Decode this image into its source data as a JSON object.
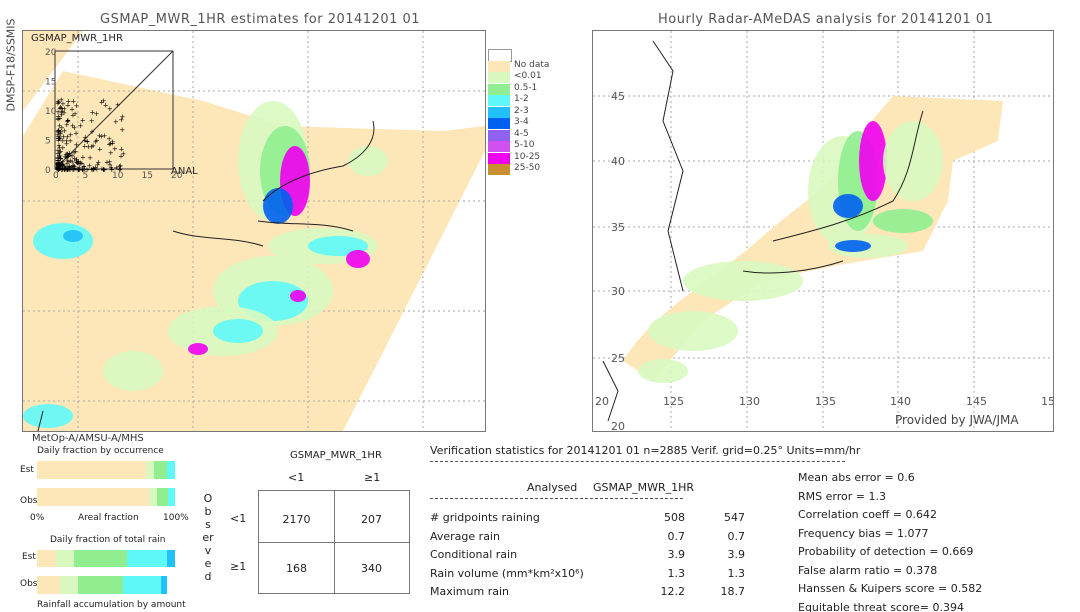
{
  "left_map": {
    "title": "GSMAP_MWR_1HR estimates for 20141201 01",
    "side_label": "DMSP-F18/SSMIS",
    "inset_label": "GSMAP_MWR_1HR",
    "inset_x_label": "ANAL",
    "inset_ticks": [
      "0",
      "5",
      "10",
      "15",
      "20"
    ],
    "bottom_label": "MetOp-A/AMSU-A/MHS"
  },
  "right_map": {
    "title": "Hourly Radar-AMeDAS analysis for 20141201 01",
    "lat_labels": [
      "45",
      "40",
      "35",
      "30",
      "25",
      "20"
    ],
    "lon_labels": [
      "20",
      "125",
      "130",
      "135",
      "140",
      "145",
      "15"
    ],
    "credit": "Provided by JWA/JMA"
  },
  "legend": {
    "items": [
      {
        "label": "",
        "color": "#ffffff"
      },
      {
        "label": "No data",
        "color": "#fde6b8"
      },
      {
        "label": "<0.01",
        "color": "#d8f8c0"
      },
      {
        "label": "0.5-1",
        "color": "#90ee90"
      },
      {
        "label": "1-2",
        "color": "#5ff8f8"
      },
      {
        "label": "2-3",
        "color": "#20c0f8"
      },
      {
        "label": "3-4",
        "color": "#0060f0"
      },
      {
        "label": "4-5",
        "color": "#9060f0"
      },
      {
        "label": "5-10",
        "color": "#d050f0"
      },
      {
        "label": "10-25",
        "color": "#f000f0"
      },
      {
        "label": "25-50",
        "color": "#c89030"
      }
    ]
  },
  "occurrence": {
    "title": "Daily fraction by occurrence",
    "est_label": "Est",
    "obs_label": "Obs",
    "axis_left": "0%",
    "axis_mid": "Areal fraction",
    "axis_right": "100%",
    "est": [
      0.79,
      0.06,
      0.09,
      0.06
    ],
    "obs": [
      0.81,
      0.06,
      0.08,
      0.05
    ]
  },
  "total_rain": {
    "title": "Daily fraction of total rain",
    "est_label": "Est",
    "obs_label": "Obs",
    "footer": "Rainfall accumulation by amount",
    "est": [
      0.14,
      0.13,
      0.38,
      0.29,
      0.06
    ],
    "obs": [
      0.17,
      0.13,
      0.32,
      0.28,
      0.04
    ]
  },
  "contingency": {
    "title": "GSMAP_MWR_1HR",
    "col_headers": [
      "<1",
      "≥1"
    ],
    "row_headers": [
      "<1",
      "≥1"
    ],
    "observed_label": "Observed",
    "cells": [
      [
        "2170",
        "207"
      ],
      [
        "168",
        "340"
      ]
    ]
  },
  "stats": {
    "header": "Verification statistics for 20141201 01   n=2885   Verif. grid=0.25°   Units=mm/hr",
    "col_analysed": "Analysed",
    "col_est": "GSMAP_MWR_1HR",
    "rows": [
      {
        "label": "# gridpoints raining",
        "analysed": "508",
        "est": "547"
      },
      {
        "label": "Average rain",
        "analysed": "0.7",
        "est": "0.7"
      },
      {
        "label": "Conditional rain",
        "analysed": "3.9",
        "est": "3.9"
      },
      {
        "label": "Rain volume (mm*km²x10⁶)",
        "analysed": "1.3",
        "est": "1.3"
      },
      {
        "label": "Maximum rain",
        "analysed": "12.2",
        "est": "18.7"
      }
    ],
    "scores": [
      "Mean abs error = 0.6",
      "RMS error = 1.3",
      "Correlation coeff = 0.642",
      "Frequency bias = 1.077",
      "Probability of detection = 0.669",
      "False alarm ratio = 0.378",
      "Hanssen & Kuipers score = 0.582",
      "Equitable threat score= 0.394"
    ]
  }
}
